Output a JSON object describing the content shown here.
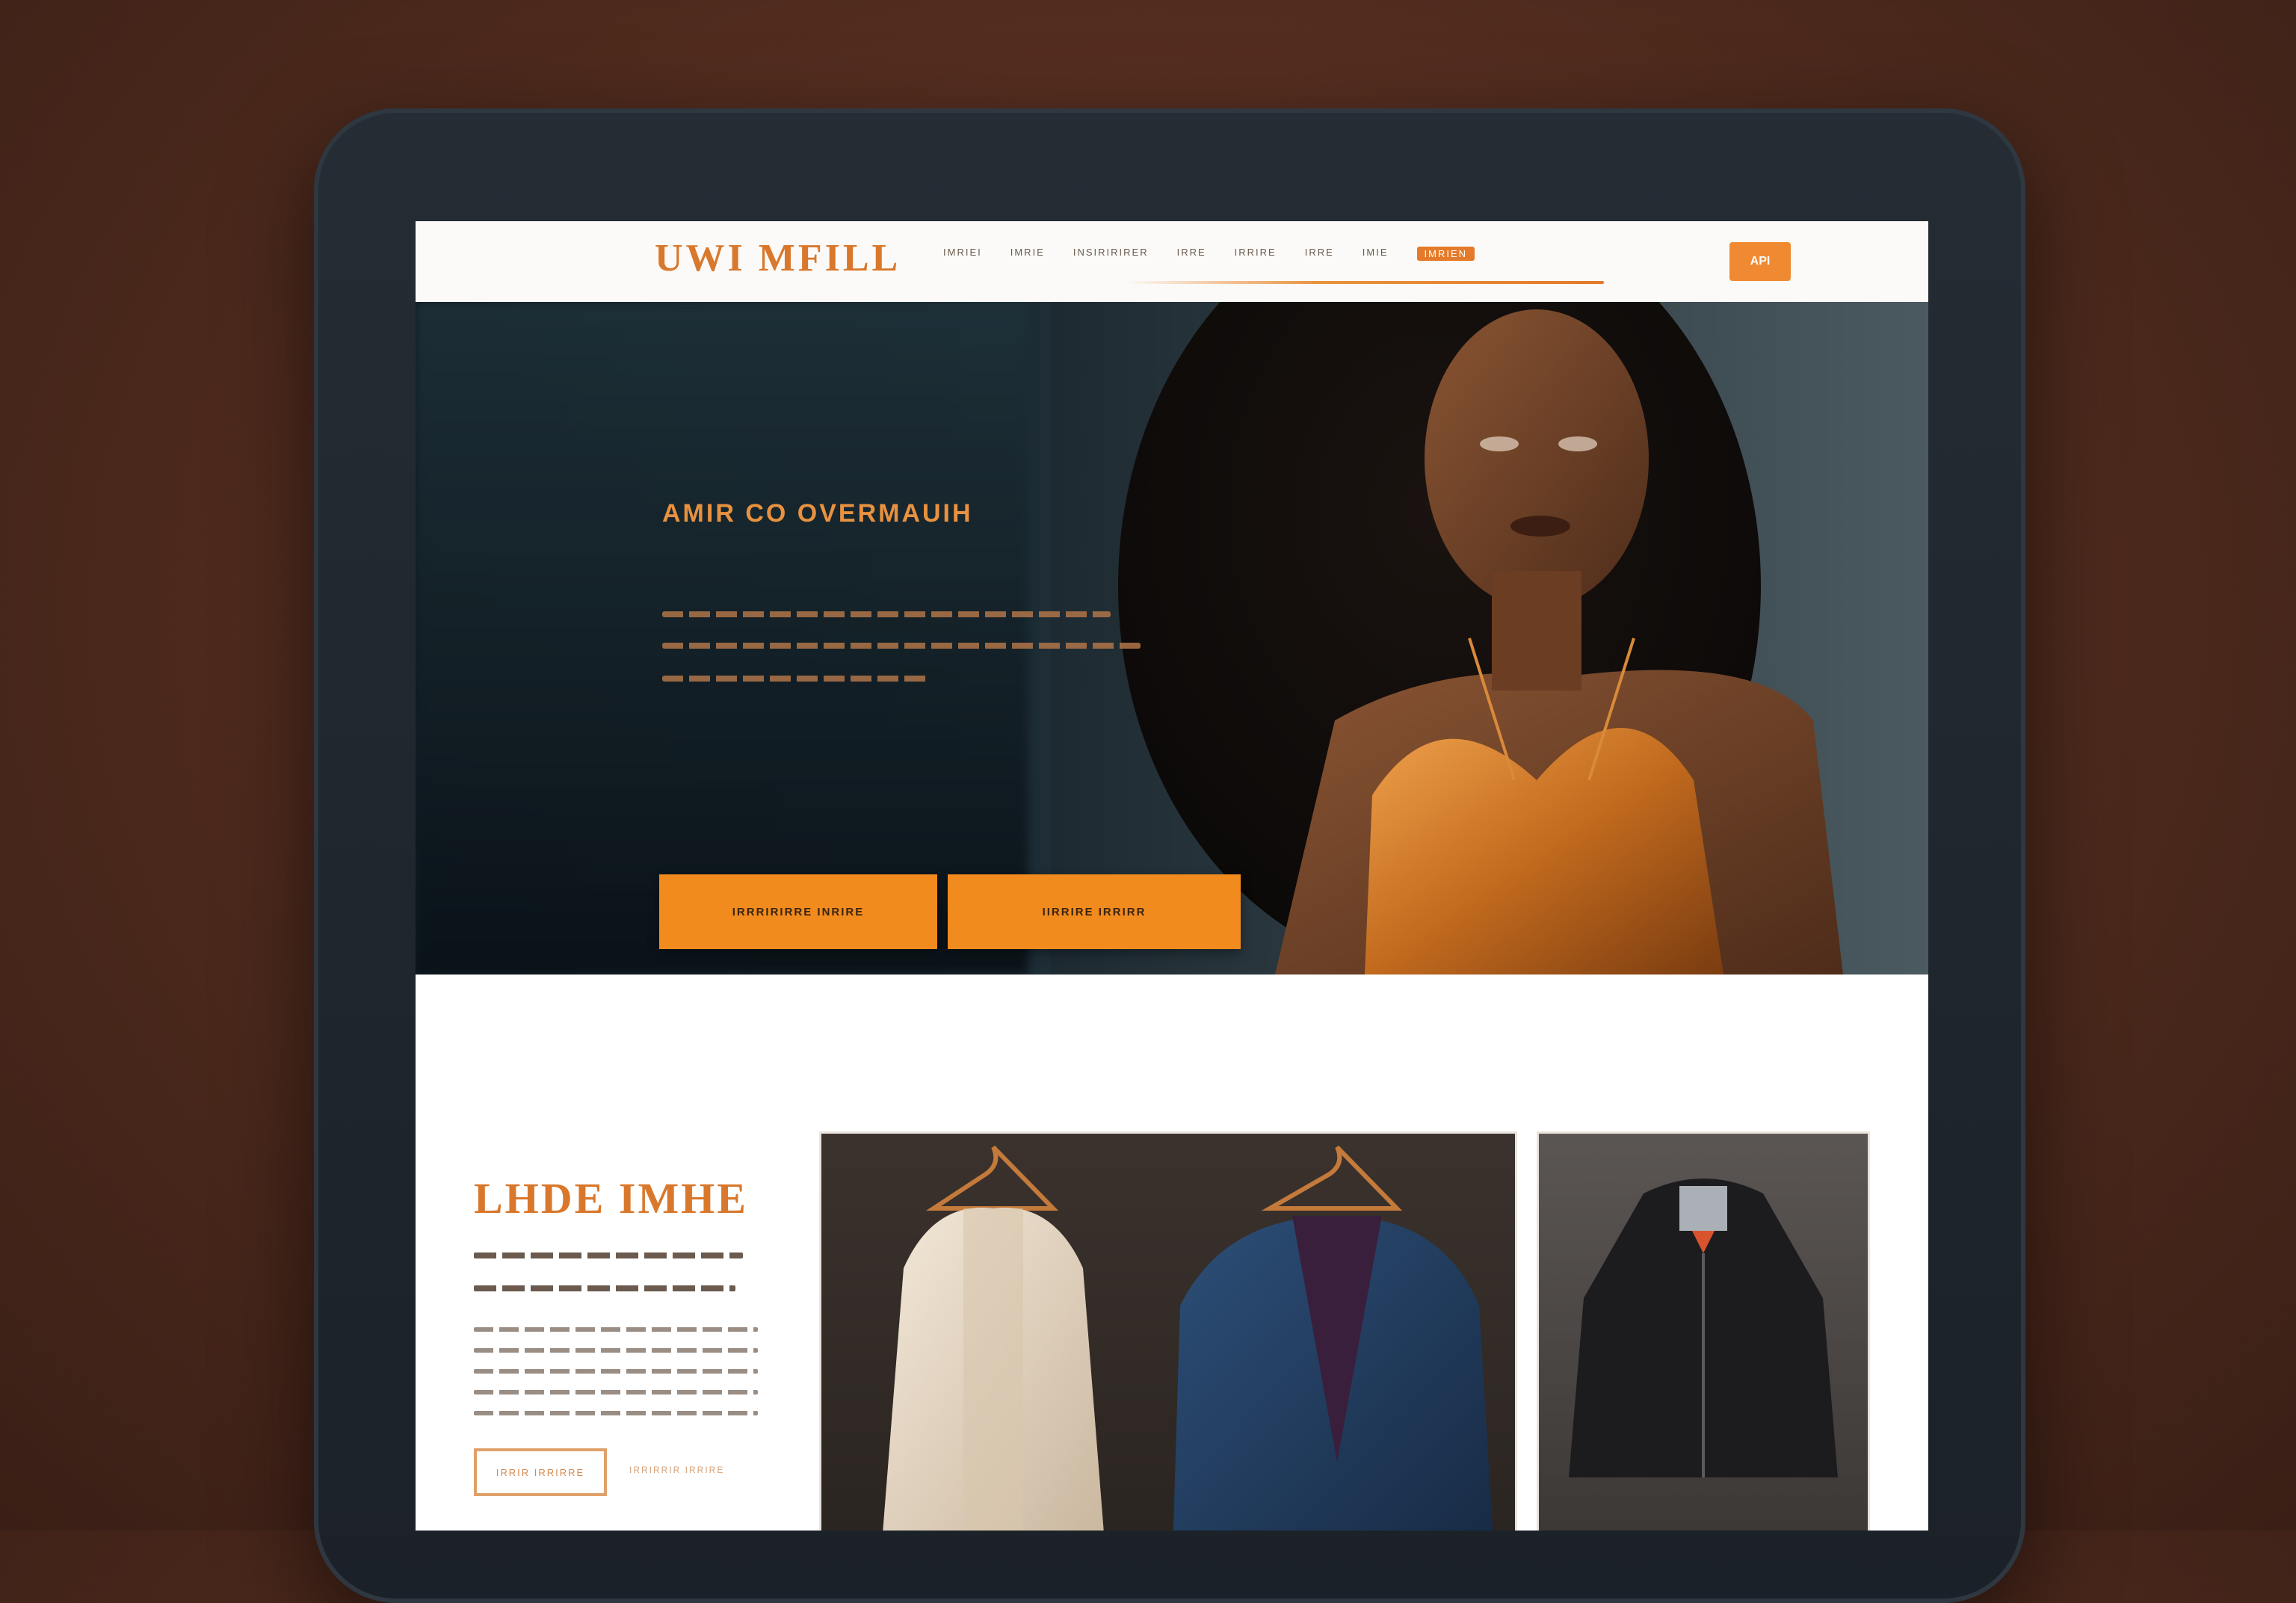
{
  "header": {
    "logo": "UWI MFILL",
    "nav": [
      "IMRIEI",
      "IMRIE",
      "INSIRIRIRER",
      "IRRE",
      "IRRIRE",
      "IRRE",
      "IMIE"
    ],
    "nav_active": "IMRIEN",
    "cta_label": "API"
  },
  "hero": {
    "title": "AMIR CO OVERMAUIH",
    "primary_button": "IRRRIRIRRE INRIRE",
    "secondary_button": "IIRRIRE IRRIRR"
  },
  "section": {
    "title": "LHDE IMHE",
    "subtitle_line_1": "DO DUIRRRIRE DIRRRIRE RIRIR",
    "subtitle_line_2": "DIRIRIRIRRIRE DIRRIRRIRRIR",
    "button_label": "IRRIR IRRIRRE",
    "link_label": "IRRIRRIR IRRIRE"
  },
  "colors": {
    "accent": "#f28b1e",
    "brand_text": "#d9782c",
    "backdrop": "#4e2a1d",
    "bezel": "#1f252c"
  },
  "icons": {
    "hanger": "hanger-icon"
  }
}
